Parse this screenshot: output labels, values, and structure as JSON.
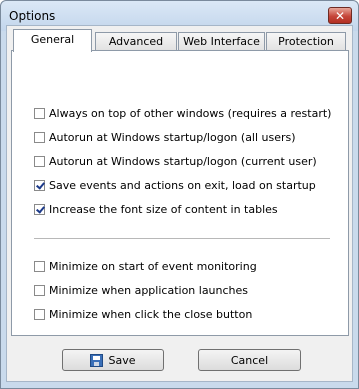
{
  "window": {
    "title": "Options",
    "close_glyph": "✕"
  },
  "tabs": [
    {
      "label": "General",
      "active": true
    },
    {
      "label": "Advanced",
      "active": false
    },
    {
      "label": "Web Interface",
      "active": false
    },
    {
      "label": "Protection",
      "active": false
    }
  ],
  "options_group1": [
    {
      "label": "Always on top of other windows (requires a restart)",
      "checked": false
    },
    {
      "label": "Autorun at Windows startup/logon (all users)",
      "checked": false
    },
    {
      "label": "Autorun at Windows startup/logon (current user)",
      "checked": false
    },
    {
      "label": "Save events and actions on exit, load on startup",
      "checked": true
    },
    {
      "label": "Increase the font size of content in tables",
      "checked": true
    }
  ],
  "options_group2": [
    {
      "label": "Minimize on start of event monitoring",
      "checked": false
    },
    {
      "label": "Minimize when application launches",
      "checked": false
    },
    {
      "label": "Minimize when click the close button",
      "checked": false
    }
  ],
  "buttons": {
    "save_label": "Save",
    "cancel_label": "Cancel"
  },
  "icons": {
    "save": "save-icon",
    "checkbox_checked": "checkmark-icon"
  }
}
